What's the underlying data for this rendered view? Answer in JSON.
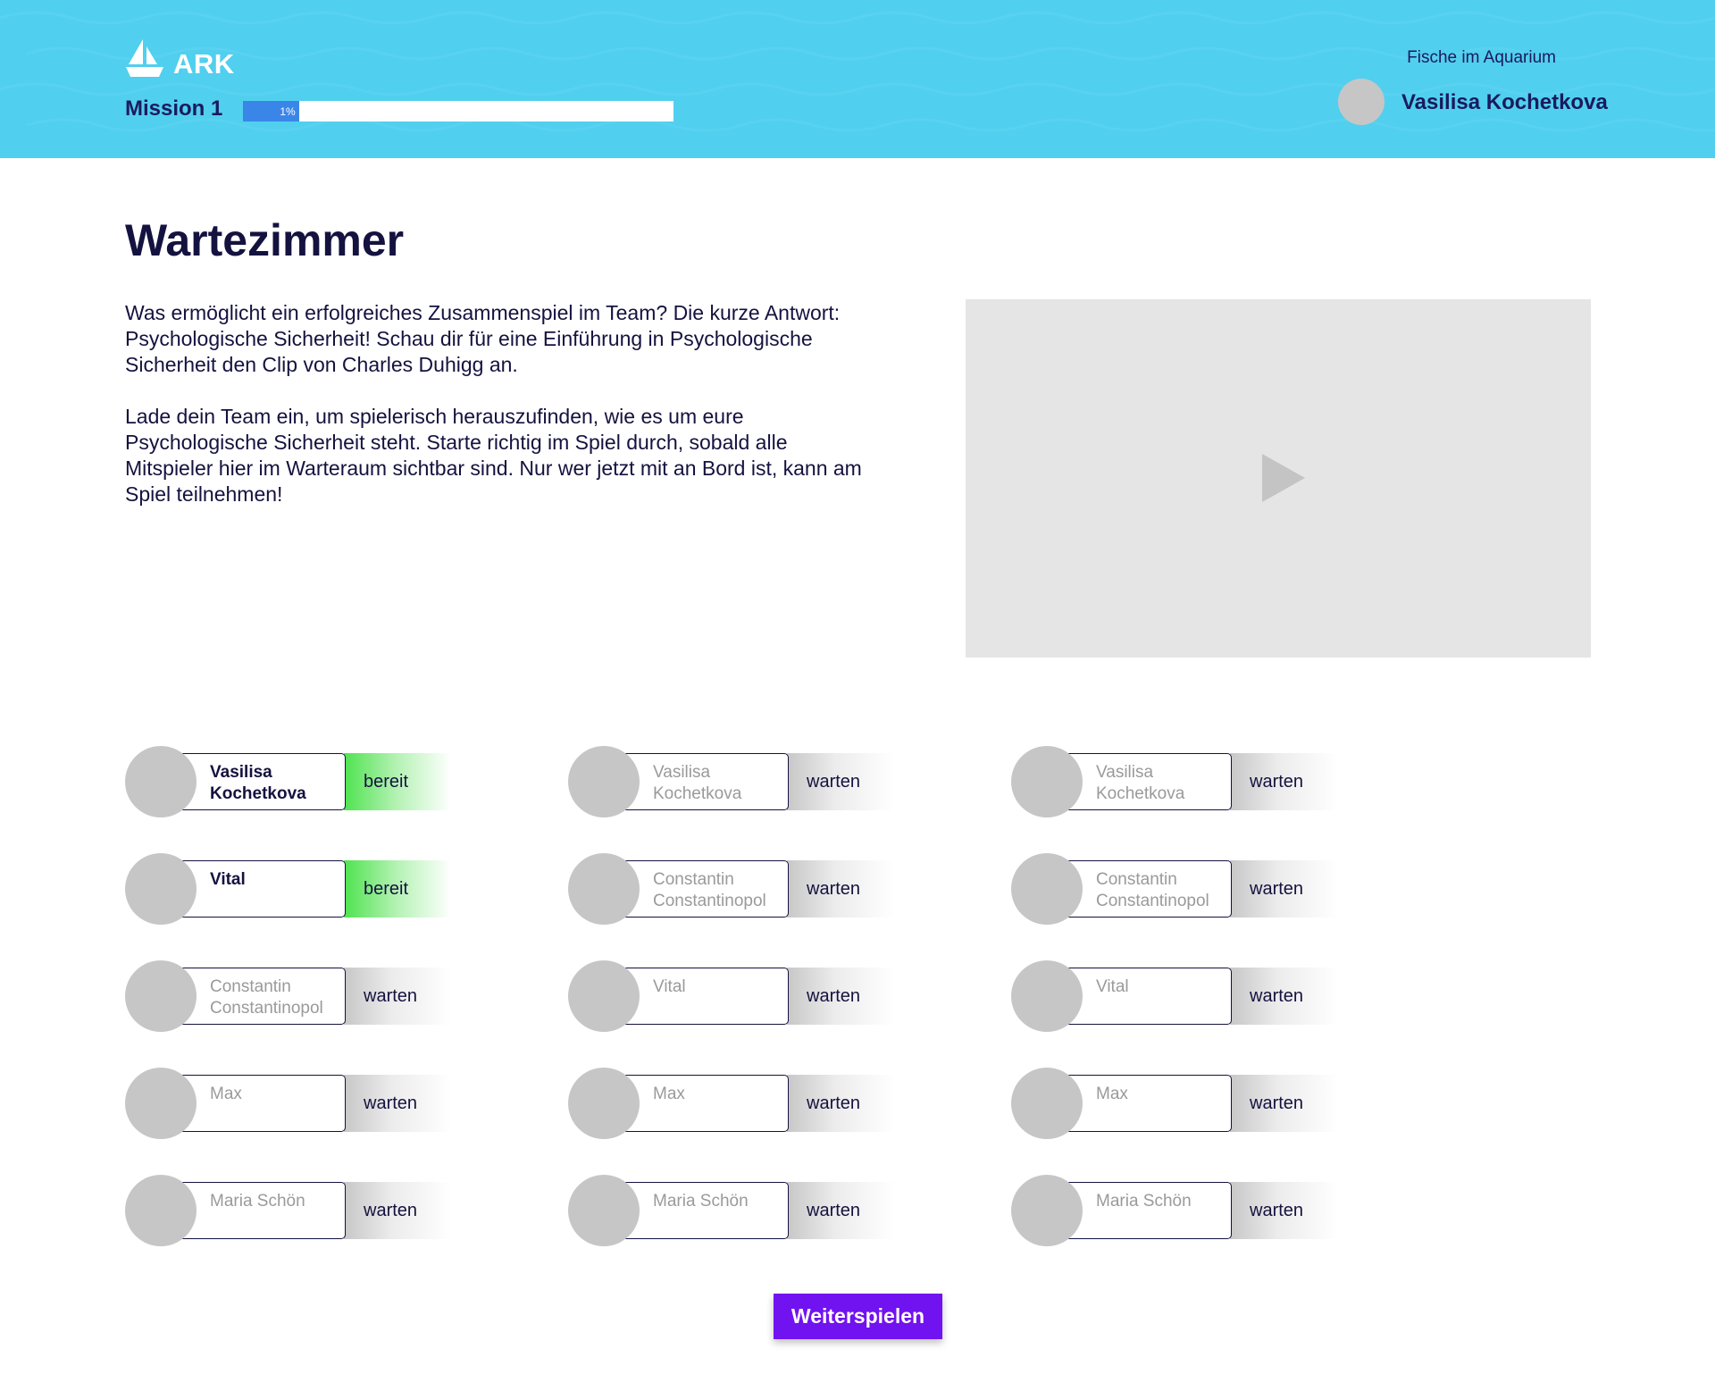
{
  "header": {
    "brand": "ARK",
    "logo_icon": "sailboat-icon",
    "mission_label": "Mission 1",
    "progress": {
      "percent": 13,
      "label": "1%"
    },
    "team_name": "Fische im Aquarium",
    "user_name": "Vasilisa Kochetkova",
    "background_color": "#51cfee"
  },
  "main": {
    "title": "Wartezimmer",
    "intro_paragraphs": [
      "Was ermöglicht ein erfolgreiches Zusammenspiel im Team? Die kurze Antwort: Psychologische Sicherheit! Schau dir für eine Einführung in Psychologische Sicherheit den Clip von Charles Duhigg an.",
      "Lade dein Team ein, um spielerisch herauszufinden, wie es um eure Psychologische Sicherheit steht. Starte richtig im Spiel durch, sobald alle Mitspieler hier im Warteraum sichtbar sind. Nur wer jetzt mit an Bord ist, kann am Spiel teilnehmen!"
    ],
    "video": {
      "icon": "play-icon"
    }
  },
  "players": [
    [
      {
        "name": "Vasilisa Kochetkova",
        "status": "bereit",
        "ready": true
      },
      {
        "name": "Vital",
        "status": "bereit",
        "ready": true
      },
      {
        "name": "Constantin Constantinopol",
        "status": "warten",
        "ready": false
      },
      {
        "name": "Max",
        "status": "warten",
        "ready": false
      },
      {
        "name": "Maria Schön",
        "status": "warten",
        "ready": false
      }
    ],
    [
      {
        "name": "Vasilisa Kochetkova",
        "status": "warten",
        "ready": false
      },
      {
        "name": "Constantin Constantinopol",
        "status": "warten",
        "ready": false
      },
      {
        "name": "Vital",
        "status": "warten",
        "ready": false
      },
      {
        "name": "Max",
        "status": "warten",
        "ready": false
      },
      {
        "name": "Maria Schön",
        "status": "warten",
        "ready": false
      }
    ],
    [
      {
        "name": "Vasilisa Kochetkova",
        "status": "warten",
        "ready": false
      },
      {
        "name": "Constantin Constantinopol",
        "status": "warten",
        "ready": false
      },
      {
        "name": "Vital",
        "status": "warten",
        "ready": false
      },
      {
        "name": "Max",
        "status": "warten",
        "ready": false
      },
      {
        "name": "Maria Schön",
        "status": "warten",
        "ready": false
      }
    ]
  ],
  "actions": {
    "continue_label": "Weiterspielen",
    "continue_color": "#7112f0"
  },
  "colors": {
    "ready": "#4fe34f",
    "waiting": "#c7c7c7",
    "progress": "#3a86e8"
  }
}
